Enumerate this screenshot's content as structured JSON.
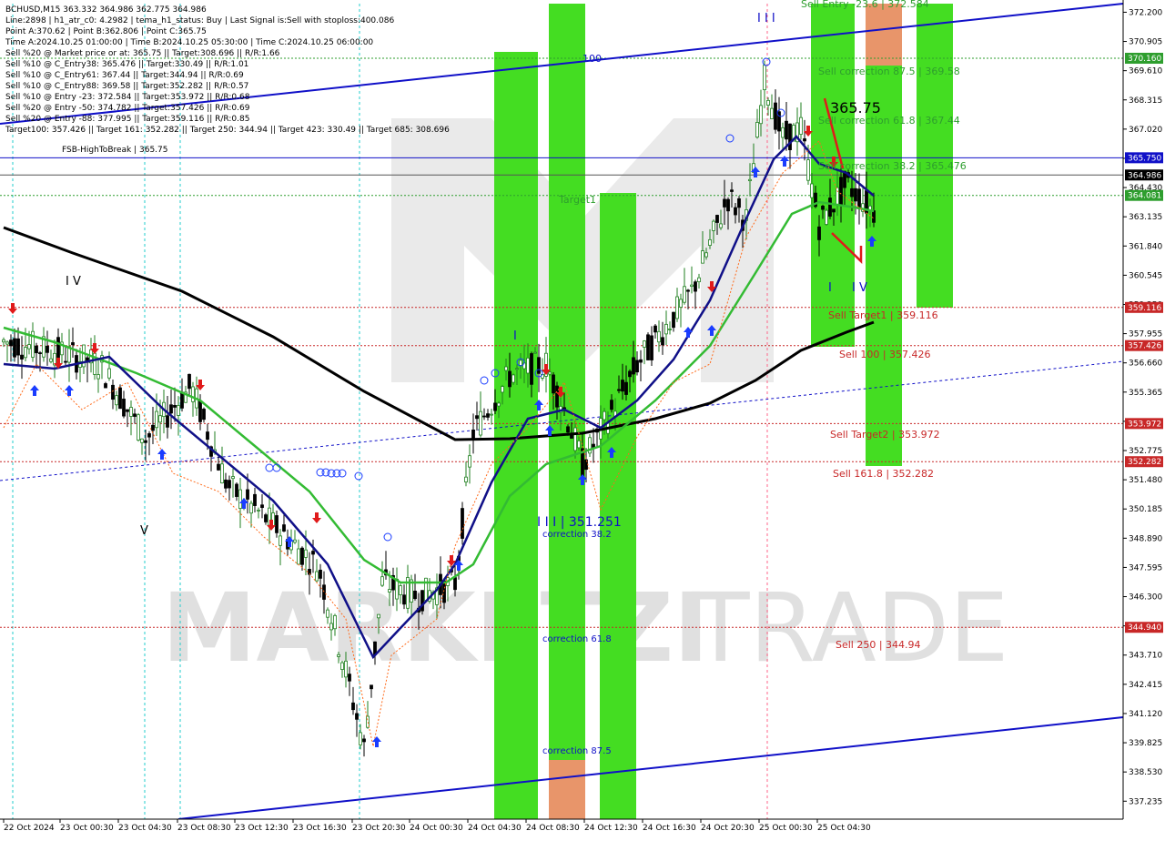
{
  "header": {
    "lines": [
      "BCHUSD,M15  363.332 364.986 362.775 364.986",
      "Line:2898 | h1_atr_c0: 4.2982 | tema_h1_status: Buy | Last Signal is:Sell with stoploss:400.086",
      "Point A:370.62 | Point B:362.806 | Point C:365.75",
      "Time A:2024.10.25 01:00:00 | Time B:2024.10.25 05:30:00 | Time C:2024.10.25 06:00:00",
      "Sell %20 @ Market price or at: 365.75 || Target:308.696 || R/R:1.66",
      "Sell %10 @ C_Entry38: 365.476 || Target:330.49 || R/R:1.01",
      "Sell %10 @ C_Entry61: 367.44 || Target:344.94 || R/R:0.69",
      "Sell %10 @ C_Entry88: 369.58 || Target:352.282 || R/R:0.57",
      "Sell %10 @ Entry -23: 372.584 || Target:353.972 || R/R:0.68",
      "Sell %20 @ Entry -50: 374.782 || Target:357.426 || R/R:0.69",
      "Sell %20 @ Entry -88: 377.995 || Target:359.116 || R/R:0.85",
      "Target100: 357.426 || Target 161: 352.282 || Target 250: 344.94 || Target 423: 330.49 || Target 685: 308.696"
    ]
  },
  "watermark": {
    "text1": "MARKETZI",
    "text2": "TRADE"
  },
  "chart_data": {
    "type": "candlestick",
    "symbol": "BCHUSD",
    "timeframe": "M15",
    "ylim": [
      336.6,
      372.5
    ],
    "y_ticks": [
      "372.200",
      "370.905",
      "369.610",
      "368.315",
      "367.020",
      "365.725",
      "364.430",
      "363.135",
      "361.840",
      "360.545",
      "359.250",
      "357.955",
      "356.660",
      "355.365",
      "354.070",
      "352.775",
      "351.480",
      "350.185",
      "348.890",
      "347.595",
      "346.300",
      "345.005",
      "343.710",
      "342.415",
      "341.120",
      "339.825",
      "338.530",
      "337.235"
    ],
    "x_labels": [
      "22 Oct 2024",
      "23 Oct 00:30",
      "23 Oct 04:30",
      "23 Oct 08:30",
      "23 Oct 12:30",
      "23 Oct 16:30",
      "23 Oct 20:30",
      "24 Oct 00:30",
      "24 Oct 04:30",
      "24 Oct 08:30",
      "24 Oct 12:30",
      "24 Oct 16:30",
      "24 Oct 20:30",
      "25 Oct 00:30",
      "25 Oct 04:30"
    ],
    "price_tags": [
      {
        "value": 370.16,
        "label": "370.160",
        "bg": "#2e9e2e",
        "fg": "#ffffff"
      },
      {
        "value": 365.75,
        "label": "365.750",
        "bg": "#1010c8",
        "fg": "#ffffff"
      },
      {
        "value": 364.986,
        "label": "364.986",
        "bg": "#000000",
        "fg": "#ffffff"
      },
      {
        "value": 364.081,
        "label": "364.081",
        "bg": "#2e9e2e",
        "fg": "#ffffff"
      },
      {
        "value": 359.116,
        "label": "359.116",
        "bg": "#c82828",
        "fg": "#ffffff"
      },
      {
        "value": 357.426,
        "label": "357.426",
        "bg": "#c82828",
        "fg": "#ffffff"
      },
      {
        "value": 353.972,
        "label": "353.972",
        "bg": "#c82828",
        "fg": "#ffffff"
      },
      {
        "value": 352.282,
        "label": "352.282",
        "bg": "#c82828",
        "fg": "#ffffff"
      },
      {
        "value": 344.94,
        "label": "344.940",
        "bg": "#c82828",
        "fg": "#ffffff"
      }
    ],
    "level_labels": [
      {
        "text": "FSB-HighToBreak | 365.75",
        "value": 365.75,
        "color": "#000000"
      },
      {
        "text": "Sell Entry -23.6 | 372.584",
        "value": 372.584,
        "color": "#2e9e2e"
      },
      {
        "text": "Sell correction 87.5 | 369.58",
        "value": 369.58,
        "color": "#2e9e2e"
      },
      {
        "text": "Sell correction 61.8 | 367.44",
        "value": 367.44,
        "color": "#2e9e2e"
      },
      {
        "text": "Sell correction 38.2 | 365.476",
        "value": 365.476,
        "color": "#2e9e2e"
      },
      {
        "text": "Sell Target1 | 359.116",
        "value": 359.116,
        "color": "#c82828"
      },
      {
        "text": "Sell 100 | 357.426",
        "value": 357.426,
        "color": "#c82828"
      },
      {
        "text": "Sell Target2 | 353.972",
        "value": 353.972,
        "color": "#c82828"
      },
      {
        "text": "Sell 161.8 | 352.282",
        "value": 352.282,
        "color": "#c82828"
      },
      {
        "text": "Sell 250 | 344.94",
        "value": 344.94,
        "color": "#c82828"
      }
    ],
    "annotations": [
      {
        "text": "365.75",
        "color": "#000000"
      },
      {
        "text": "I I I | 351.251",
        "color": "#1010c8"
      },
      {
        "text": "100",
        "color": "#1010c8"
      },
      {
        "text": "Target1",
        "color": "#2e9e2e"
      },
      {
        "text": "correction 38.2",
        "color": "#1010c8"
      },
      {
        "text": "correction 61.8",
        "color": "#1010c8"
      },
      {
        "text": "correction 87.5",
        "color": "#1010c8"
      },
      {
        "text": "I V",
        "color": "#000000"
      },
      {
        "text": "V",
        "color": "#000000"
      },
      {
        "text": "I",
        "color": "#1010c8"
      },
      {
        "text": "I I I",
        "color": "#1010c8"
      },
      {
        "text": "I",
        "color": "#1010c8"
      },
      {
        "text": "I V",
        "color": "#1010c8"
      }
    ],
    "colors": {
      "zone_green": "#44dd22",
      "zone_orange": "#e8956a",
      "trend_blue": "#1010c8",
      "ma_green": "#33bb33",
      "ma_navy": "#101088",
      "ma_black": "#000000",
      "bull_candle": "#1f7f1f",
      "bear_candle": "#000000"
    }
  }
}
